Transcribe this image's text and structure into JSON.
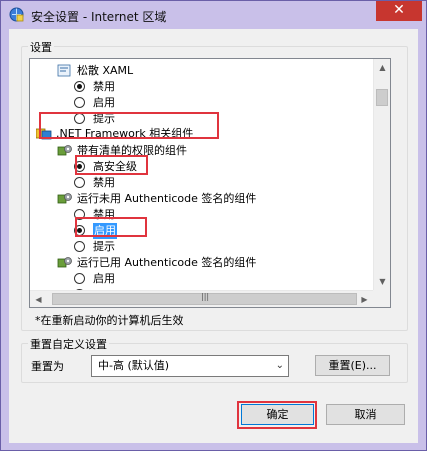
{
  "window": {
    "title": "安全设置 - Internet 区域",
    "close": "✕"
  },
  "settings_group": {
    "label": "设置"
  },
  "list": {
    "rows": [
      {
        "type": "header",
        "label": "松散 XAML"
      },
      {
        "type": "option",
        "label": "禁用",
        "checked": true
      },
      {
        "type": "option",
        "label": "启用",
        "checked": false
      },
      {
        "type": "option",
        "label": "提示",
        "checked": false
      },
      {
        "type": "category",
        "label": ".NET Framework 相关组件"
      },
      {
        "type": "header",
        "label": "带有清单的权限的组件"
      },
      {
        "type": "option",
        "label": "高安全级",
        "checked": true
      },
      {
        "type": "option",
        "label": "禁用",
        "checked": false
      },
      {
        "type": "header",
        "label": "运行未用 Authenticode 签名的组件"
      },
      {
        "type": "option",
        "label": "禁用",
        "checked": false
      },
      {
        "type": "option",
        "label": "启用",
        "checked": true,
        "selected": true
      },
      {
        "type": "option",
        "label": "提示",
        "checked": false
      },
      {
        "type": "header",
        "label": "运行已用 Authenticode 签名的组件"
      },
      {
        "type": "option",
        "label": "启用",
        "checked": false
      },
      {
        "type": "option",
        "label": "",
        "checked": false
      }
    ],
    "scroll_up": "▲",
    "scroll_down": "▼",
    "scroll_left": "◀",
    "scroll_right": "▶",
    "grip": "|||"
  },
  "restart_note": "*在重新启动你的计算机后生效",
  "reset_group": {
    "label": "重置自定义设置",
    "reset_to_label": "重置为",
    "select_value": "中-高 (默认值)",
    "reset_button": "重置(E)..."
  },
  "buttons": {
    "ok": "确定",
    "cancel": "取消"
  },
  "colors": {
    "highlight": "#e0343e",
    "selection": "#3399ff",
    "title_bg": "#c9c0e9",
    "close_bg": "#c7362f"
  }
}
